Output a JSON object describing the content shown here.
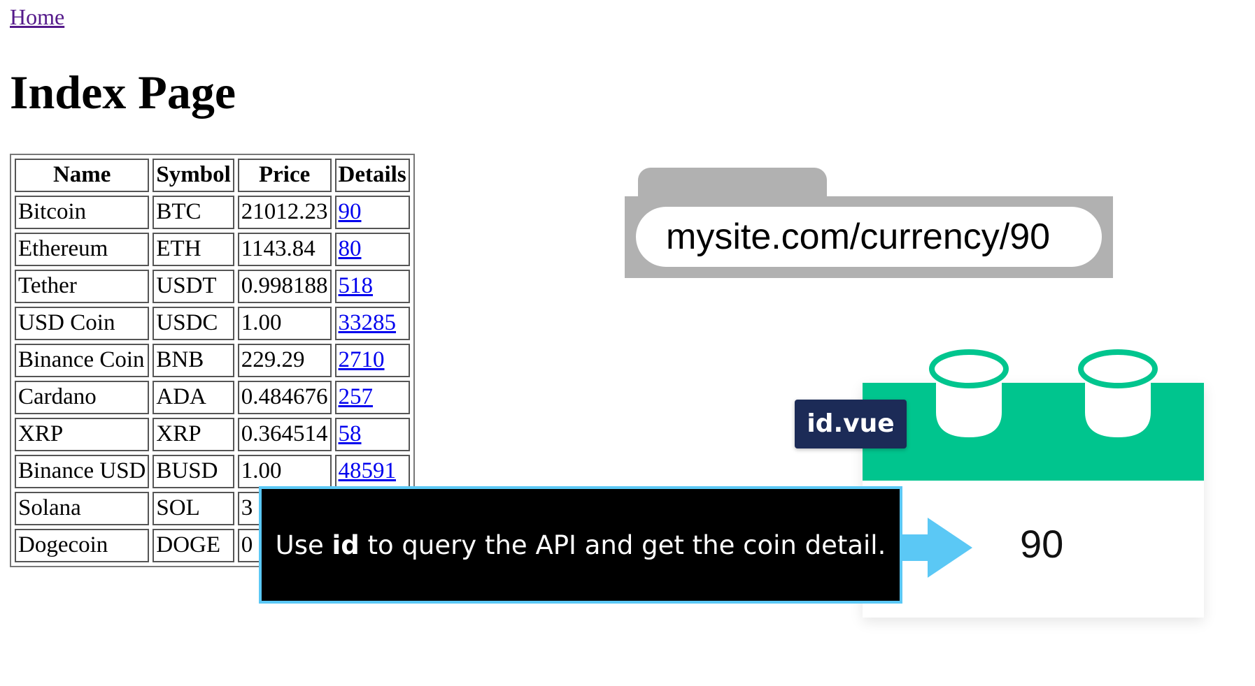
{
  "nav": {
    "home_label": "Home"
  },
  "page": {
    "title": "Index Page"
  },
  "table": {
    "headers": [
      "Name",
      "Symbol",
      "Price",
      "Details"
    ],
    "rows": [
      [
        "Bitcoin",
        "BTC",
        "21012.23",
        "90"
      ],
      [
        "Ethereum",
        "ETH",
        "1143.84",
        "80"
      ],
      [
        "Tether",
        "USDT",
        "0.998188",
        "518"
      ],
      [
        "USD Coin",
        "USDC",
        "1.00",
        "33285"
      ],
      [
        "Binance Coin",
        "BNB",
        "229.29",
        "2710"
      ],
      [
        "Cardano",
        "ADA",
        "0.484676",
        "257"
      ],
      [
        "XRP",
        "XRP",
        "0.364514",
        "58"
      ],
      [
        "Binance USD",
        "BUSD",
        "1.00",
        "48591"
      ],
      [
        "Solana",
        "SOL",
        "3",
        ""
      ],
      [
        "Dogecoin",
        "DOGE",
        "0",
        ""
      ]
    ]
  },
  "browser": {
    "url": "mysite.com/currency/90"
  },
  "component": {
    "filename": "id.vue",
    "value": "90"
  },
  "caption": {
    "prefix": "Use ",
    "keyword": "id",
    "suffix": " to query the API and get the coin detail."
  },
  "colors": {
    "accent_green": "#00c58e",
    "badge_navy": "#1c2b57",
    "caption_border": "#5bc8f5",
    "link_blue": "#0000ee",
    "visited_purple": "#551a8b",
    "browser_gray": "#b1b1b1"
  },
  "icons": [
    "arrow-right-icon",
    "cup-icon"
  ]
}
